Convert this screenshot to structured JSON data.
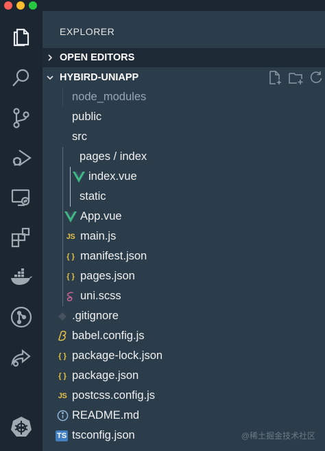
{
  "explorer": {
    "title": "EXPLORER",
    "open_editors_label": "OPEN EDITORS",
    "project_label": "HYBIRD-UNIAPP"
  },
  "activity_bar": {
    "icons": [
      "files-icon",
      "search-icon",
      "source-control-icon",
      "run-debug-icon",
      "remote-explorer-icon",
      "extensions-icon",
      "docker-icon",
      "git-graph-icon",
      "live-share-icon",
      "kubernetes-icon"
    ]
  },
  "tree": [
    {
      "label": "node_modules",
      "icon": "none",
      "dim": true
    },
    {
      "label": "public",
      "icon": "none"
    },
    {
      "label": "src",
      "icon": "none"
    },
    {
      "label": "pages / index",
      "icon": "none"
    },
    {
      "label": "index.vue",
      "icon": "vue-icon"
    },
    {
      "label": "static",
      "icon": "none"
    },
    {
      "label": "App.vue",
      "icon": "vue-icon"
    },
    {
      "label": "main.js",
      "icon": "js-icon"
    },
    {
      "label": "manifest.json",
      "icon": "json-icon"
    },
    {
      "label": "pages.json",
      "icon": "json-icon"
    },
    {
      "label": "uni.scss",
      "icon": "sass-icon"
    },
    {
      "label": ".gitignore",
      "icon": "git-icon"
    },
    {
      "label": "babel.config.js",
      "icon": "babel-icon"
    },
    {
      "label": "package-lock.json",
      "icon": "json-icon"
    },
    {
      "label": "package.json",
      "icon": "json-icon"
    },
    {
      "label": "postcss.config.js",
      "icon": "js-icon"
    },
    {
      "label": "README.md",
      "icon": "info-icon"
    },
    {
      "label": "tsconfig.json",
      "icon": "ts-icon"
    }
  ],
  "icon_glyphs": {
    "js": "JS",
    "json": "{ }",
    "ts": "TS"
  },
  "watermark": "@稀土掘金技术社区",
  "colors": {
    "sidebar_bg": "#2b3c4a",
    "activity_bg": "#1b2630",
    "vue_green": "#41b883",
    "js_yellow": "#e5c145",
    "sass_pink": "#cd6799",
    "ts_blue": "#3f7fc2"
  }
}
